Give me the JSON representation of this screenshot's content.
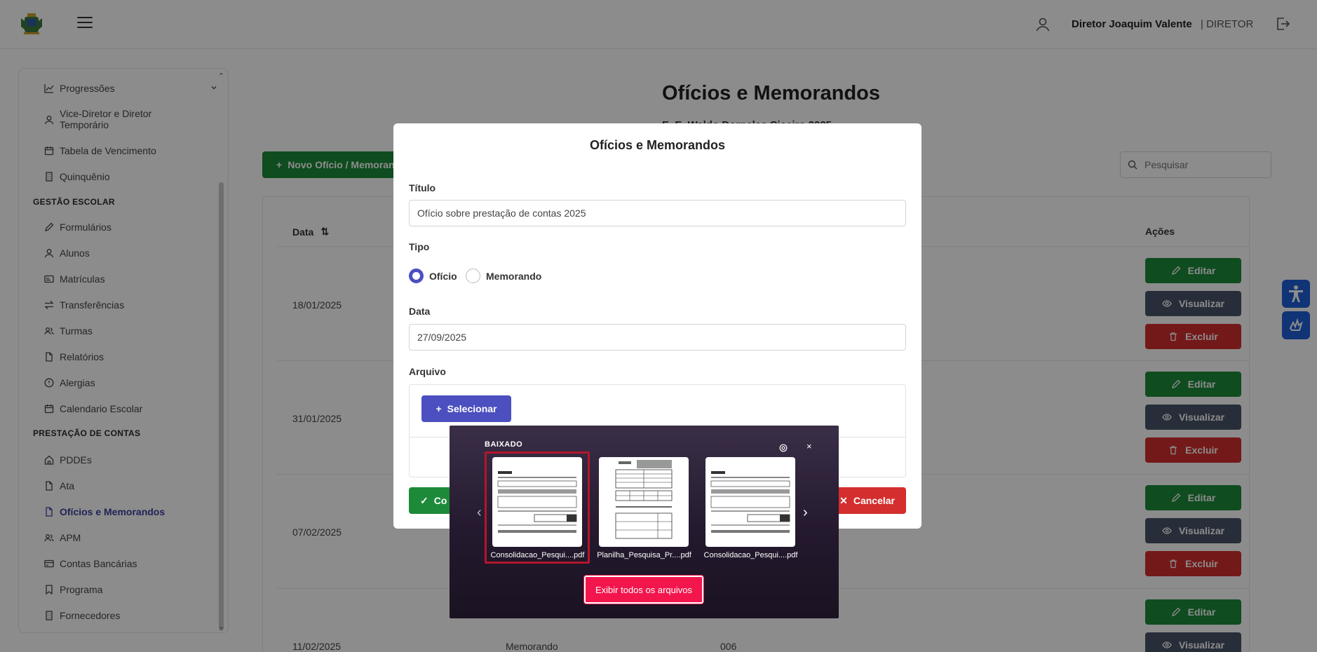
{
  "header": {
    "user_name": "Diretor Joaquim Valente",
    "user_role": "| DIRETOR"
  },
  "sidebar": {
    "items_top": [
      {
        "label": "Progressões",
        "icon": "chart-line-icon"
      },
      {
        "label": "Vice-Diretor e Diretor Temporário",
        "icon": "user-icon"
      },
      {
        "label": "Tabela de Vencimento",
        "icon": "calendar-icon"
      },
      {
        "label": "Quinquênio",
        "icon": "building-icon"
      }
    ],
    "section_escolar": "GESTÃO ESCOLAR",
    "items_escolar": [
      {
        "label": "Formulários",
        "icon": "pencil-icon"
      },
      {
        "label": "Alunos",
        "icon": "user-icon"
      },
      {
        "label": "Matrículas",
        "icon": "id-card-icon"
      },
      {
        "label": "Transferências",
        "icon": "transfer-icon"
      },
      {
        "label": "Turmas",
        "icon": "users-icon"
      },
      {
        "label": "Relatórios",
        "icon": "file-icon"
      },
      {
        "label": "Alergias",
        "icon": "alert-circle-icon"
      },
      {
        "label": "Calendario Escolar",
        "icon": "calendar-icon"
      }
    ],
    "section_contas": "PRESTAÇÃO DE CONTAS",
    "items_contas": [
      {
        "label": "PDDEs",
        "icon": "home-icon"
      },
      {
        "label": "Ata",
        "icon": "file-icon"
      },
      {
        "label": "Ofícios e Memorandos",
        "icon": "file-icon",
        "active": true
      },
      {
        "label": "APM",
        "icon": "users-icon"
      },
      {
        "label": "Contas Bancárias",
        "icon": "bank-card-icon"
      },
      {
        "label": "Programa",
        "icon": "bookmark-icon"
      },
      {
        "label": "Fornecedores",
        "icon": "building-icon"
      }
    ]
  },
  "main": {
    "title": "Ofícios e Memorandos",
    "subtitle": "E. E. Waldo Dorneles Ciceiro 2025",
    "new_button": "Novo Ofício / Memorando",
    "search_placeholder": "Pesquisar",
    "table": {
      "col_data": "Data",
      "col_acoes": "Ações",
      "rows": [
        {
          "date": "18/01/2025",
          "tipo": "",
          "numero": ""
        },
        {
          "date": "31/01/2025",
          "tipo": "",
          "numero": ""
        },
        {
          "date": "07/02/2025",
          "tipo": "",
          "numero": ""
        },
        {
          "date": "11/02/2025",
          "tipo": "Memorando",
          "numero": "006"
        }
      ],
      "actions": {
        "edit": "Editar",
        "view": "Visualizar",
        "delete": "Excluir"
      }
    }
  },
  "modal": {
    "title": "Ofícios e Memorandos",
    "label_titulo": "Título",
    "value_titulo": "Ofício sobre prestação de contas 2025",
    "label_tipo": "Tipo",
    "radio_oficio": "Ofício",
    "radio_memorando": "Memorando",
    "selected_tipo": "Ofício",
    "label_data": "Data",
    "value_data": "27/09/2025",
    "label_arquivo": "Arquivo",
    "select_button": "Selecionar",
    "confirm_button": "Co",
    "cancel_button": "Cancelar"
  },
  "download_popup": {
    "header": "BAIXADO",
    "files": [
      {
        "name": "Consolidacao_Pesqui....pdf",
        "selected": true
      },
      {
        "name": "Planilha_Pesquisa_Pr....pdf",
        "selected": false
      },
      {
        "name": "Consolidacao_Pesqui....pdf",
        "selected": false
      }
    ],
    "show_all_button": "Exibir todos os arquivos"
  },
  "colors": {
    "primary": "#4b4fc0",
    "success": "#1d8a3a",
    "danger": "#d42e2e",
    "neutral_button": "#4a5468",
    "download_accent": "#f2164d",
    "accessibility": "#1e5fd8"
  }
}
